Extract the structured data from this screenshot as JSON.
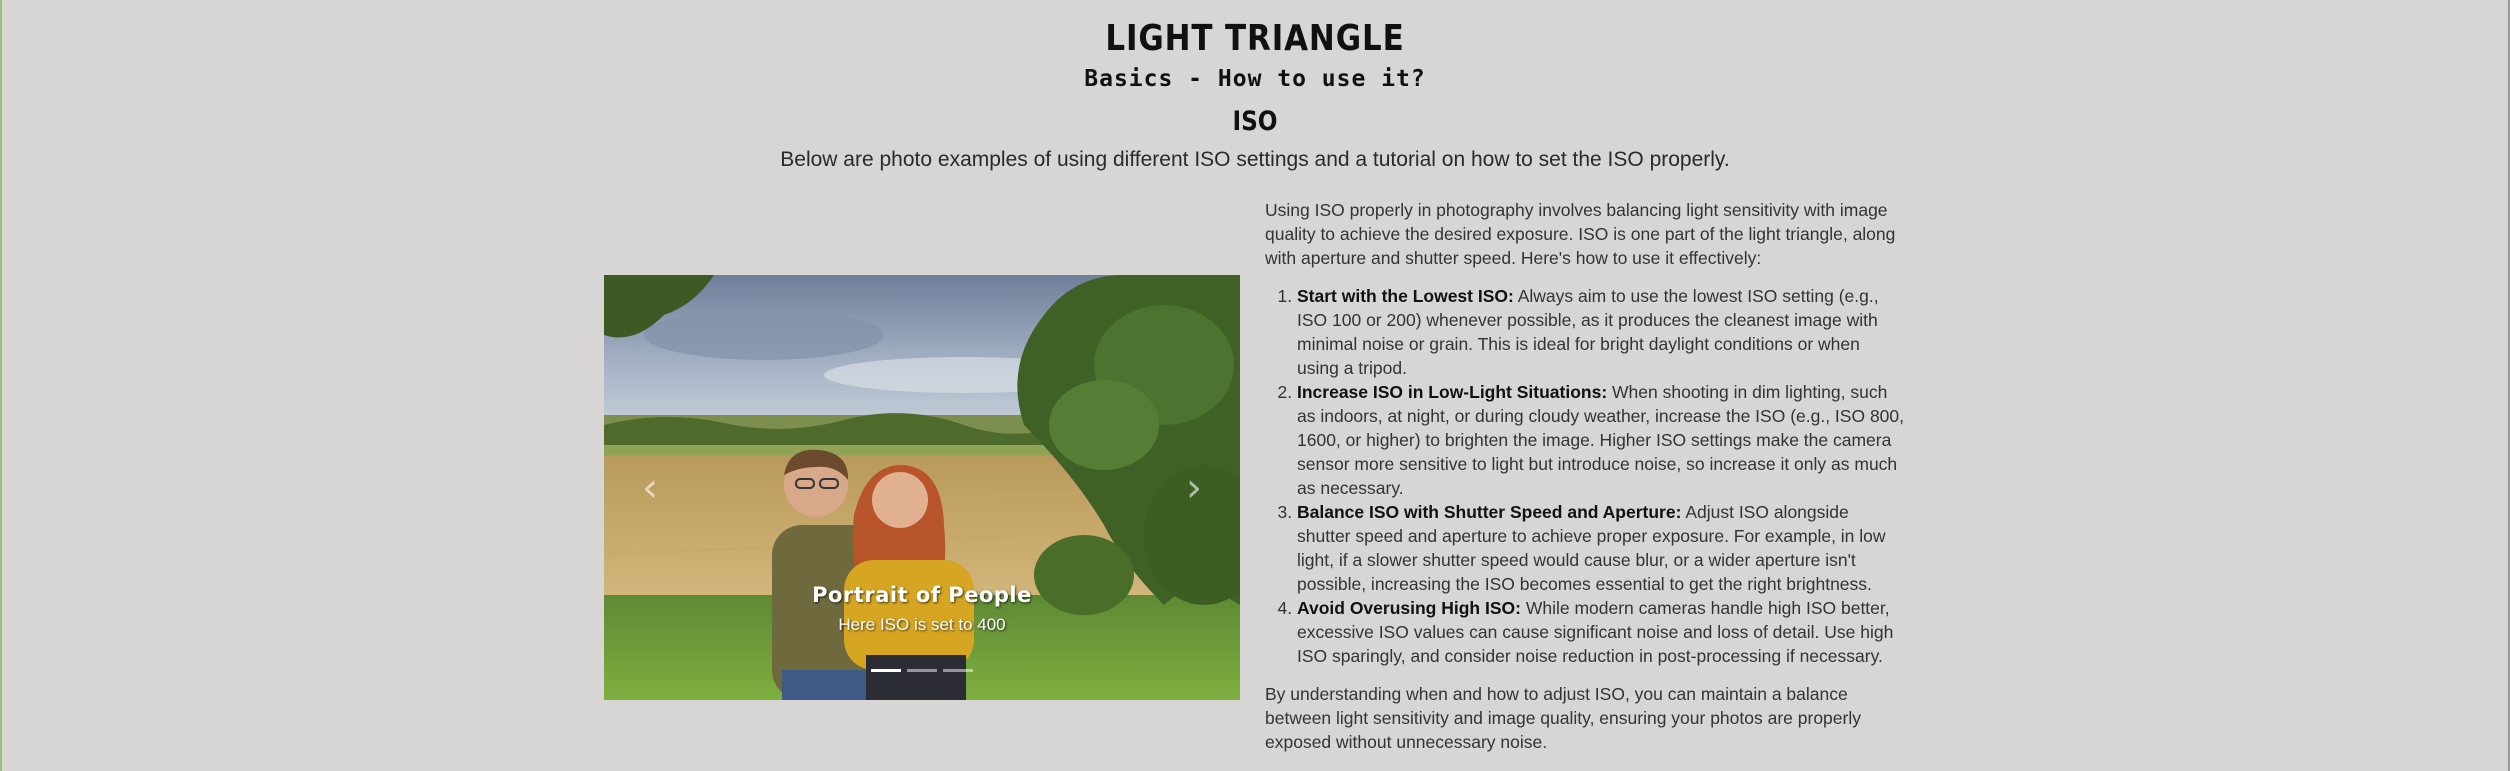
{
  "header": {
    "title": "LIGHT TRIANGLE",
    "subtitle": "Basics - How to use it?",
    "section_title": "ISO",
    "intro": "Below are photo examples of using different ISO settings and a tutorial on how to set the ISO properly."
  },
  "carousel": {
    "prev_icon": "chevron-left-icon",
    "next_icon": "chevron-right-icon",
    "prev_glyph": "‹",
    "next_glyph": "›",
    "caption_title": "Portrait of People",
    "caption_text": "Here ISO is set to 400",
    "slide_count": 3,
    "active_slide": 1
  },
  "article": {
    "intro": "Using ISO properly in photography involves balancing light sensitivity with image quality to achieve the desired exposure. ISO is one part of the light triangle, along with aperture and shutter speed. Here's how to use it effectively:",
    "steps": [
      {
        "title": "Start with the Lowest ISO:",
        "text": " Always aim to use the lowest ISO setting (e.g., ISO 100 or 200) whenever possible, as it produces the cleanest image with minimal noise or grain. This is ideal for bright daylight conditions or when using a tripod."
      },
      {
        "title": "Increase ISO in Low-Light Situations:",
        "text": " When shooting in dim lighting, such as indoors, at night, or during cloudy weather, increase the ISO (e.g., ISO 800, 1600, or higher) to brighten the image. Higher ISO settings make the camera sensor more sensitive to light but introduce noise, so increase it only as much as necessary."
      },
      {
        "title": "Balance ISO with Shutter Speed and Aperture:",
        "text": " Adjust ISO alongside shutter speed and aperture to achieve proper exposure. For example, in low light, if a slower shutter speed would cause blur, or a wider aperture isn't possible, increasing the ISO becomes essential to get the right brightness."
      },
      {
        "title": "Avoid Overusing High ISO:",
        "text": " While modern cameras handle high ISO better, excessive ISO values can cause significant noise and loss of detail. Use high ISO sparingly, and consider noise reduction in post-processing if necessary."
      }
    ],
    "closing": "By understanding when and how to adjust ISO, you can maintain a balance between light sensitivity and image quality, ensuring your photos are properly exposed without unnecessary noise."
  },
  "colors": {
    "background": "#d8d6d4",
    "text": "#2a2a2a",
    "heading": "#111111"
  }
}
